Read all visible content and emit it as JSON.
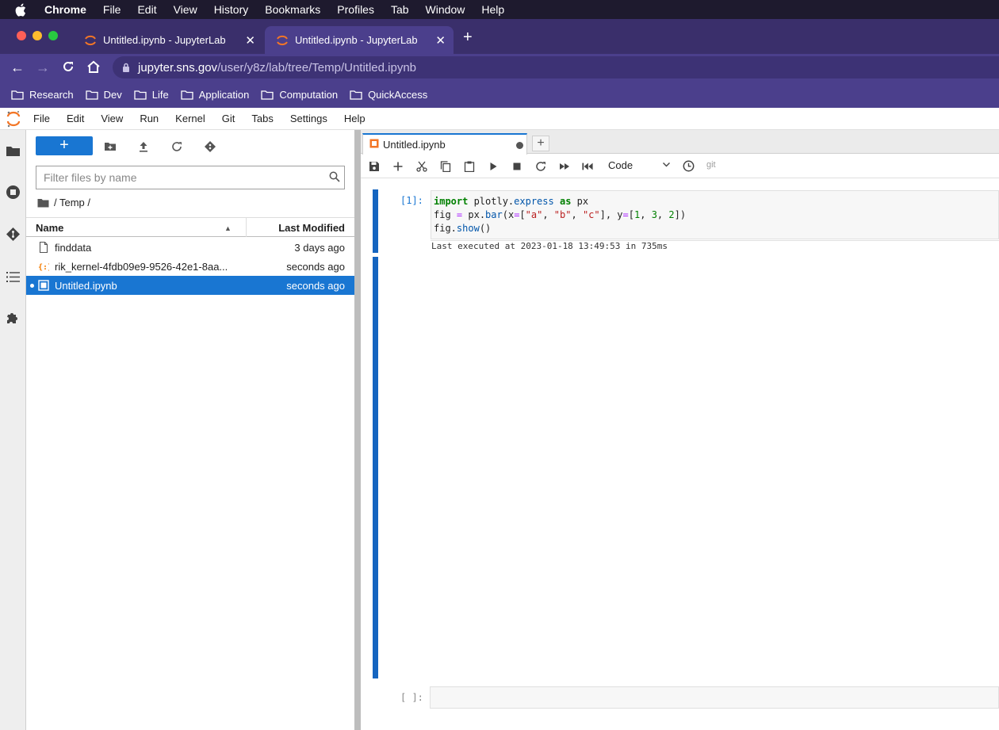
{
  "os_menu": {
    "app": "Chrome",
    "items": [
      "File",
      "Edit",
      "View",
      "History",
      "Bookmarks",
      "Profiles",
      "Tab",
      "Window",
      "Help"
    ]
  },
  "browser": {
    "tabs": [
      {
        "title": "Untitled.ipynb - JupyterLab",
        "active": false
      },
      {
        "title": "Untitled.ipynb - JupyterLab",
        "active": true
      }
    ],
    "url": {
      "host": "jupyter.sns.gov",
      "path": "/user/y8z/lab/tree/Temp/Untitled.ipynb"
    },
    "bookmarks": [
      "Research",
      "Dev",
      "Life",
      "Application",
      "Computation",
      "QuickAccess"
    ]
  },
  "jupyter": {
    "menu": [
      "File",
      "Edit",
      "View",
      "Run",
      "Kernel",
      "Git",
      "Tabs",
      "Settings",
      "Help"
    ],
    "sidebar_icons": [
      "folder-icon",
      "stop-circle-icon",
      "git-icon",
      "toc-icon",
      "extension-icon"
    ],
    "filebrowser": {
      "new_label": "+",
      "filter_placeholder": "Filter files by name",
      "breadcrumb": "/ Temp /",
      "col_name": "Name",
      "col_modified": "Last Modified",
      "files": [
        {
          "name": "finddata",
          "modified": "3 days ago",
          "type": "file",
          "selected": false
        },
        {
          "name": "rik_kernel-4fdb09e9-9526-42e1-8aa...",
          "modified": "seconds ago",
          "type": "json",
          "selected": false
        },
        {
          "name": "Untitled.ipynb",
          "modified": "seconds ago",
          "type": "notebook",
          "selected": true
        }
      ]
    },
    "notebook": {
      "tab_title": "Untitled.ipynb",
      "cell_type": "Code",
      "git_label": "git",
      "cells": [
        {
          "prompt": "[1]:",
          "code": [
            "import plotly.express as px",
            "fig = px.bar(x=[\"a\", \"b\", \"c\"], y=[1, 3, 2])",
            "fig.show()"
          ],
          "exec_info": "Last executed at 2023-01-18 13:49:53 in 735ms"
        },
        {
          "prompt": "[ ]:",
          "code": []
        }
      ]
    }
  },
  "colors": {
    "accent": "#1976d2",
    "chrome_purple": "#4b3f8c",
    "mac_bar": "#1e1a2e"
  }
}
